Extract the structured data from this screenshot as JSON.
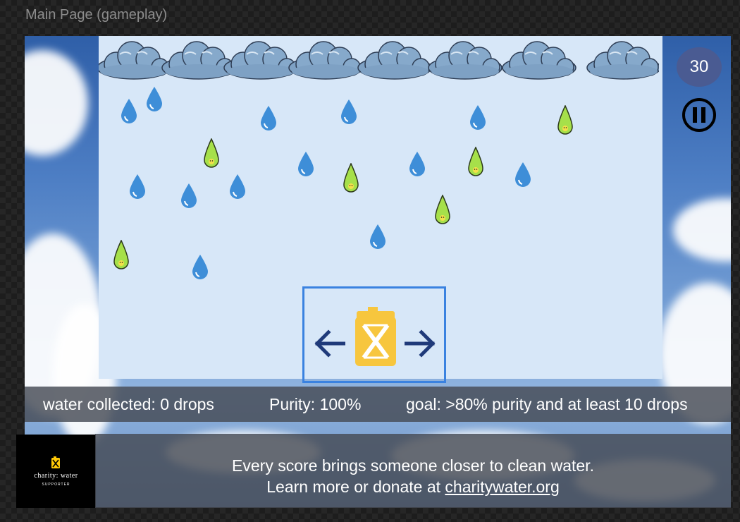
{
  "frame_title": "Main Page (gameplay)",
  "game": {
    "timer": "30",
    "pause_icon": "pause-icon",
    "bucket_icon": "jerry-can-icon",
    "left_arrow_icon": "arrow-left-icon",
    "right_arrow_icon": "arrow-right-icon",
    "clean_drop_color": "#3e8ed8",
    "dirty_drop_color": "#a6e04a",
    "bucket_color": "#f7c63e"
  },
  "status": {
    "water_collected": "water collected: 0 drops",
    "purity": "Purity: 100%",
    "goal": "goal: >80% purity and at least 10 drops"
  },
  "footer": {
    "line1": "Every score brings someone closer to clean water.",
    "line2_prefix": "Learn more or donate at ",
    "link_text": "charitywater.org"
  },
  "badge": {
    "brand": "charity: water",
    "sub": "SUPPORTER",
    "brand_color": "#ffc907"
  }
}
